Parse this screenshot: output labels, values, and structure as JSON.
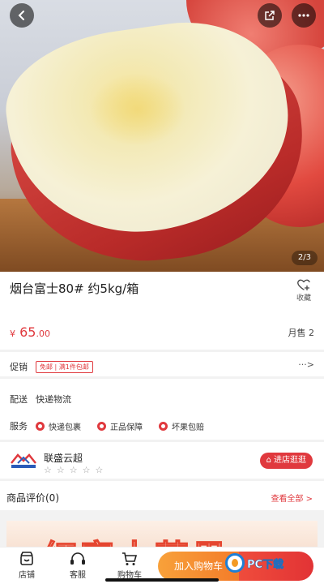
{
  "product": {
    "image_pager": "2/3",
    "title": "烟台富士80# 约5kg/箱",
    "favorite_label": "收藏",
    "price_symbol": "¥",
    "price_main": "65",
    "price_decimal": ".00",
    "sales": "月售 2"
  },
  "promo": {
    "label": "促销",
    "badge": "免邮 | 满1件包邮",
    "more": "···>"
  },
  "shipping": {
    "label": "配送",
    "value": "快递物流"
  },
  "service": {
    "label": "服务",
    "items": [
      "快递包裹",
      "正品保障",
      "坏果包赔"
    ]
  },
  "store": {
    "name": "联盛云超",
    "rating_stars": "☆☆☆☆☆",
    "enter_label": "进店逛逛"
  },
  "reviews": {
    "title": "商品评价(0)",
    "view_all": "查看全部 >"
  },
  "banner": {
    "text": "红富士苹果"
  },
  "bottom_bar": {
    "tabs": [
      {
        "label": "店铺"
      },
      {
        "label": "客服"
      },
      {
        "label": "购物车"
      }
    ],
    "add_to_cart": "加入购物车",
    "watermark": "PC下载"
  },
  "colors": {
    "accent_red": "#e0393e",
    "cart_orange": "#f5902f"
  }
}
